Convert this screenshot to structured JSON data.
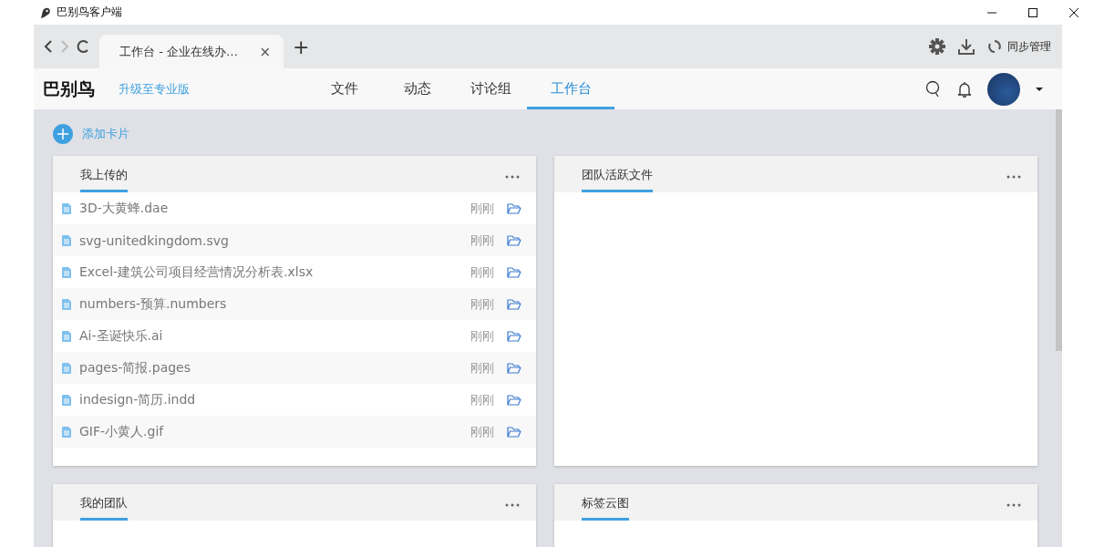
{
  "window": {
    "title": "巴别鸟客户端"
  },
  "browser": {
    "tabs": [
      {
        "label": "工作台 - 企业在线办…",
        "close": "×",
        "selected": true
      }
    ],
    "new_tab": "+",
    "sync": "同步管理"
  },
  "header": {
    "logo": "巴别鸟",
    "upgrade": "升级至专业版",
    "nav": [
      {
        "label": "文件",
        "selected": false
      },
      {
        "label": "动态",
        "selected": false
      },
      {
        "label": "讨论组",
        "selected": false
      },
      {
        "label": "工作台",
        "selected": true
      }
    ]
  },
  "add_card": "添加卡片",
  "cards": [
    {
      "title": "我上传的",
      "files": [
        {
          "name": "3D-大黄蜂.dae",
          "time": "刚刚"
        },
        {
          "name": "svg-unitedkingdom.svg",
          "time": "刚刚"
        },
        {
          "name": "Excel-建筑公司项目经营情况分析表.xlsx",
          "time": "刚刚"
        },
        {
          "name": "numbers-预算.numbers",
          "time": "刚刚"
        },
        {
          "name": "Ai-圣诞快乐.ai",
          "time": "刚刚"
        },
        {
          "name": "pages-简报.pages",
          "time": "刚刚"
        },
        {
          "name": "indesign-简历.indd",
          "time": "刚刚"
        },
        {
          "name": "GIF-小黄人.gif",
          "time": "刚刚"
        }
      ]
    },
    {
      "title": "团队活跃文件"
    },
    {
      "title": "我的团队"
    },
    {
      "title": "标签云图"
    }
  ]
}
